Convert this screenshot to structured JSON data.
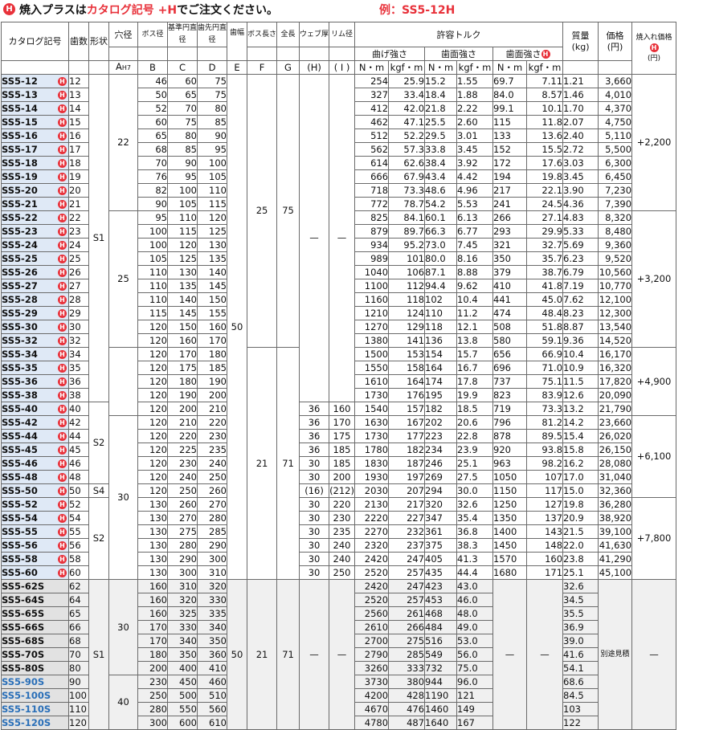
{
  "banner": {
    "h_icon": "H",
    "text_prefix": "焼入プラスは",
    "text_red": "カタログ記号 +H",
    "text_suffix": "でご注文ください。",
    "example": "例：SS5-12H"
  },
  "headers": {
    "catalog": "カタログ記号",
    "teeth": "歯数",
    "shape": "形状",
    "bore": "穴径",
    "boss_dia": "ボス径",
    "pitch_dia": "基準円直径",
    "tip_dia": "歯先円直径",
    "face_width": "歯幅",
    "boss_len": "ボス長さ",
    "total_len": "全長",
    "web": "ウェブ厚",
    "rim": "リム径",
    "torque": "許容トルク",
    "bending": "曲げ強さ",
    "surface": "歯面強さ",
    "surface_h": "歯面強さ",
    "mass": "質量",
    "mass_unit": "(kg)",
    "price": "価格",
    "price_unit": "(円)",
    "hardening_price": "焼入れ価格",
    "hardening_unit": "(円)",
    "col_A": "A",
    "col_A_sub": "H7",
    "col_B": "B",
    "col_C": "C",
    "col_D": "D",
    "col_E": "E",
    "col_F": "F",
    "col_G": "G",
    "col_H": "(H)",
    "col_I": "( I )",
    "nm": "N・m",
    "kgfm": "kgf・m",
    "nm2": "N・m",
    "kgfm2": "kgf・m",
    "nm3": "N・m",
    "kgfm3": "kgf・m"
  },
  "merged": {
    "bore_22": "22",
    "bore_25": "25",
    "bore_30a": "30",
    "bore_30b": "30",
    "bore_40": "40",
    "shape_S1a": "S1",
    "shape_S2a": "S2",
    "shape_S4": "S4",
    "shape_S2b": "S2",
    "shape_S1b": "S1",
    "E_50a": "50",
    "E_50b": "50",
    "F_25": "25",
    "F_21a": "21",
    "F_21b": "21",
    "G_75": "75",
    "G_71a": "71",
    "G_71b": "71",
    "H_dash1": "—",
    "I_dash1": "—",
    "H_dash2": "—",
    "I_dash2": "—",
    "sh_dash1": "—",
    "sk_dash1": "—",
    "price_note": "別途見積",
    "hp_dash": "—",
    "hp_2200": "+2,200",
    "hp_3200": "+3,200",
    "hp_4900": "+4,900",
    "hp_6100": "+6,100",
    "hp_7800": "+7,800"
  },
  "rows": [
    {
      "cat": "SS5-12",
      "h": "H",
      "z": "12",
      "b": "46",
      "c": "60",
      "d": "75",
      "bn": "254",
      "bk": "25.9",
      "sn": "15.2",
      "sk": "1.55",
      "hn": "69.7",
      "hk": "7.11",
      "m": "1.21",
      "p": "3,660"
    },
    {
      "cat": "SS5-13",
      "h": "H",
      "z": "13",
      "b": "50",
      "c": "65",
      "d": "75",
      "bn": "327",
      "bk": "33.4",
      "sn": "18.4",
      "sk": "1.88",
      "hn": "84.0",
      "hk": "8.57",
      "m": "1.46",
      "p": "4,010"
    },
    {
      "cat": "SS5-14",
      "h": "H",
      "z": "14",
      "b": "52",
      "c": "70",
      "d": "80",
      "bn": "412",
      "bk": "42.0",
      "sn": "21.8",
      "sk": "2.22",
      "hn": "99.1",
      "hk": "10.1",
      "m": "1.70",
      "p": "4,370"
    },
    {
      "cat": "SS5-15",
      "h": "H",
      "z": "15",
      "b": "60",
      "c": "75",
      "d": "85",
      "bn": "462",
      "bk": "47.1",
      "sn": "25.5",
      "sk": "2.60",
      "hn": "115",
      "hk": "11.8",
      "m": "2.07",
      "p": "4,750"
    },
    {
      "cat": "SS5-16",
      "h": "H",
      "z": "16",
      "b": "65",
      "c": "80",
      "d": "90",
      "bn": "512",
      "bk": "52.2",
      "sn": "29.5",
      "sk": "3.01",
      "hn": "133",
      "hk": "13.6",
      "m": "2.40",
      "p": "5,110"
    },
    {
      "cat": "SS5-17",
      "h": "H",
      "z": "17",
      "b": "68",
      "c": "85",
      "d": "95",
      "bn": "562",
      "bk": "57.3",
      "sn": "33.8",
      "sk": "3.45",
      "hn": "152",
      "hk": "15.5",
      "m": "2.72",
      "p": "5,500"
    },
    {
      "cat": "SS5-18",
      "h": "H",
      "z": "18",
      "b": "70",
      "c": "90",
      "d": "100",
      "bn": "614",
      "bk": "62.6",
      "sn": "38.4",
      "sk": "3.92",
      "hn": "172",
      "hk": "17.6",
      "m": "3.03",
      "p": "6,300"
    },
    {
      "cat": "SS5-19",
      "h": "H",
      "z": "19",
      "b": "76",
      "c": "95",
      "d": "105",
      "bn": "666",
      "bk": "67.9",
      "sn": "43.4",
      "sk": "4.42",
      "hn": "194",
      "hk": "19.8",
      "m": "3.45",
      "p": "6,450"
    },
    {
      "cat": "SS5-20",
      "h": "H",
      "z": "20",
      "b": "82",
      "c": "100",
      "d": "110",
      "bn": "718",
      "bk": "73.3",
      "sn": "48.6",
      "sk": "4.96",
      "hn": "217",
      "hk": "22.1",
      "m": "3.90",
      "p": "7,230"
    },
    {
      "cat": "SS5-21",
      "h": "H",
      "z": "21",
      "b": "90",
      "c": "105",
      "d": "115",
      "bn": "772",
      "bk": "78.7",
      "sn": "54.2",
      "sk": "5.53",
      "hn": "241",
      "hk": "24.5",
      "m": "4.36",
      "p": "7,390"
    },
    {
      "cat": "SS5-22",
      "h": "H",
      "z": "22",
      "b": "95",
      "c": "110",
      "d": "120",
      "bn": "825",
      "bk": "84.1",
      "sn": "60.1",
      "sk": "6.13",
      "hn": "266",
      "hk": "27.1",
      "m": "4.83",
      "p": "8,320"
    },
    {
      "cat": "SS5-23",
      "h": "H",
      "z": "23",
      "b": "100",
      "c": "115",
      "d": "125",
      "bn": "879",
      "bk": "89.7",
      "sn": "66.3",
      "sk": "6.77",
      "hn": "293",
      "hk": "29.9",
      "m": "5.33",
      "p": "8,480"
    },
    {
      "cat": "SS5-24",
      "h": "H",
      "z": "24",
      "b": "100",
      "c": "120",
      "d": "130",
      "bn": "934",
      "bk": "95.2",
      "sn": "73.0",
      "sk": "7.45",
      "hn": "321",
      "hk": "32.7",
      "m": "5.69",
      "p": "9,360"
    },
    {
      "cat": "SS5-25",
      "h": "H",
      "z": "25",
      "b": "105",
      "c": "125",
      "d": "135",
      "bn": "989",
      "bk": "101",
      "sn": "80.0",
      "sk": "8.16",
      "hn": "350",
      "hk": "35.7",
      "m": "6.23",
      "p": "9,520"
    },
    {
      "cat": "SS5-26",
      "h": "H",
      "z": "26",
      "b": "110",
      "c": "130",
      "d": "140",
      "bn": "1040",
      "bk": "106",
      "sn": "87.1",
      "sk": "8.88",
      "hn": "379",
      "hk": "38.7",
      "m": "6.79",
      "p": "10,560"
    },
    {
      "cat": "SS5-27",
      "h": "H",
      "z": "27",
      "b": "110",
      "c": "135",
      "d": "145",
      "bn": "1100",
      "bk": "112",
      "sn": "94.4",
      "sk": "9.62",
      "hn": "410",
      "hk": "41.8",
      "m": "7.19",
      "p": "10,770"
    },
    {
      "cat": "SS5-28",
      "h": "H",
      "z": "28",
      "b": "110",
      "c": "140",
      "d": "150",
      "bn": "1160",
      "bk": "118",
      "sn": "102",
      "sk": "10.4",
      "hn": "441",
      "hk": "45.0",
      "m": "7.62",
      "p": "12,100"
    },
    {
      "cat": "SS5-29",
      "h": "H",
      "z": "29",
      "b": "115",
      "c": "145",
      "d": "155",
      "bn": "1210",
      "bk": "124",
      "sn": "110",
      "sk": "11.2",
      "hn": "474",
      "hk": "48.4",
      "m": "8.23",
      "p": "12,300"
    },
    {
      "cat": "SS5-30",
      "h": "H",
      "z": "30",
      "b": "120",
      "c": "150",
      "d": "160",
      "bn": "1270",
      "bk": "129",
      "sn": "118",
      "sk": "12.1",
      "hn": "508",
      "hk": "51.8",
      "m": "8.87",
      "p": "13,540"
    },
    {
      "cat": "SS5-32",
      "h": "H",
      "z": "32",
      "b": "120",
      "c": "160",
      "d": "170",
      "bn": "1380",
      "bk": "141",
      "sn": "136",
      "sk": "13.8",
      "hn": "580",
      "hk": "59.1",
      "m": "9.36",
      "p": "14,520"
    },
    {
      "cat": "SS5-34",
      "h": "H",
      "z": "34",
      "b": "120",
      "c": "170",
      "d": "180",
      "bn": "1500",
      "bk": "153",
      "sn": "154",
      "sk": "15.7",
      "hn": "656",
      "hk": "66.9",
      "m": "10.4",
      "p": "16,170"
    },
    {
      "cat": "SS5-35",
      "h": "H",
      "z": "35",
      "b": "120",
      "c": "175",
      "d": "185",
      "bn": "1550",
      "bk": "158",
      "sn": "164",
      "sk": "16.7",
      "hn": "696",
      "hk": "71.0",
      "m": "10.9",
      "p": "16,320"
    },
    {
      "cat": "SS5-36",
      "h": "H",
      "z": "36",
      "b": "120",
      "c": "180",
      "d": "190",
      "bn": "1610",
      "bk": "164",
      "sn": "174",
      "sk": "17.8",
      "hn": "737",
      "hk": "75.1",
      "m": "11.5",
      "p": "17,820"
    },
    {
      "cat": "SS5-38",
      "h": "H",
      "z": "38",
      "b": "120",
      "c": "190",
      "d": "200",
      "bn": "1730",
      "bk": "176",
      "sn": "195",
      "sk": "19.9",
      "hn": "823",
      "hk": "83.9",
      "m": "12.6",
      "p": "20,090"
    },
    {
      "cat": "SS5-40",
      "h": "H",
      "z": "40",
      "b": "120",
      "c": "200",
      "d": "210",
      "wh": "36",
      "ri": "160",
      "bn": "1540",
      "bk": "157",
      "sn": "182",
      "sk": "18.5",
      "hn": "719",
      "hk": "73.3",
      "m": "13.2",
      "p": "21,790"
    },
    {
      "cat": "SS5-42",
      "h": "H",
      "z": "42",
      "b": "120",
      "c": "210",
      "d": "220",
      "wh": "36",
      "ri": "170",
      "bn": "1630",
      "bk": "167",
      "sn": "202",
      "sk": "20.6",
      "hn": "796",
      "hk": "81.2",
      "m": "14.2",
      "p": "23,660"
    },
    {
      "cat": "SS5-44",
      "h": "H",
      "z": "44",
      "b": "120",
      "c": "220",
      "d": "230",
      "wh": "36",
      "ri": "175",
      "bn": "1730",
      "bk": "177",
      "sn": "223",
      "sk": "22.8",
      "hn": "878",
      "hk": "89.5",
      "m": "15.4",
      "p": "26,020"
    },
    {
      "cat": "SS5-45",
      "h": "H",
      "z": "45",
      "b": "120",
      "c": "225",
      "d": "235",
      "wh": "36",
      "ri": "185",
      "bn": "1780",
      "bk": "182",
      "sn": "234",
      "sk": "23.9",
      "hn": "920",
      "hk": "93.8",
      "m": "15.8",
      "p": "26,150"
    },
    {
      "cat": "SS5-46",
      "h": "H",
      "z": "46",
      "b": "120",
      "c": "230",
      "d": "240",
      "wh": "30",
      "ri": "185",
      "bn": "1830",
      "bk": "187",
      "sn": "246",
      "sk": "25.1",
      "hn": "963",
      "hk": "98.2",
      "m": "16.2",
      "p": "28,080"
    },
    {
      "cat": "SS5-48",
      "h": "H",
      "z": "48",
      "b": "120",
      "c": "240",
      "d": "250",
      "wh": "30",
      "ri": "200",
      "bn": "1930",
      "bk": "197",
      "sn": "269",
      "sk": "27.5",
      "hn": "1050",
      "hk": "107",
      "m": "17.0",
      "p": "31,040"
    },
    {
      "cat": "SS5-50",
      "h": "H",
      "z": "50",
      "b": "120",
      "c": "250",
      "d": "260",
      "wh": "(16)",
      "ri": "(212)",
      "bn": "2030",
      "bk": "207",
      "sn": "294",
      "sk": "30.0",
      "hn": "1150",
      "hk": "117",
      "m": "15.0",
      "p": "32,360"
    },
    {
      "cat": "SS5-52",
      "h": "H",
      "z": "52",
      "b": "130",
      "c": "260",
      "d": "270",
      "wh": "30",
      "ri": "220",
      "bn": "2130",
      "bk": "217",
      "sn": "320",
      "sk": "32.6",
      "hn": "1250",
      "hk": "127",
      "m": "19.8",
      "p": "36,280"
    },
    {
      "cat": "SS5-54",
      "h": "H",
      "z": "54",
      "b": "130",
      "c": "270",
      "d": "280",
      "wh": "30",
      "ri": "230",
      "bn": "2220",
      "bk": "227",
      "sn": "347",
      "sk": "35.4",
      "hn": "1350",
      "hk": "137",
      "m": "20.9",
      "p": "38,920"
    },
    {
      "cat": "SS5-55",
      "h": "H",
      "z": "55",
      "b": "130",
      "c": "275",
      "d": "285",
      "wh": "30",
      "ri": "235",
      "bn": "2270",
      "bk": "232",
      "sn": "361",
      "sk": "36.8",
      "hn": "1400",
      "hk": "143",
      "m": "21.5",
      "p": "39,100"
    },
    {
      "cat": "SS5-56",
      "h": "H",
      "z": "56",
      "b": "130",
      "c": "280",
      "d": "290",
      "wh": "30",
      "ri": "240",
      "bn": "2320",
      "bk": "237",
      "sn": "375",
      "sk": "38.3",
      "hn": "1450",
      "hk": "148",
      "m": "22.0",
      "p": "41,630"
    },
    {
      "cat": "SS5-58",
      "h": "H",
      "z": "58",
      "b": "130",
      "c": "290",
      "d": "300",
      "wh": "30",
      "ri": "240",
      "bn": "2420",
      "bk": "247",
      "sn": "405",
      "sk": "41.3",
      "hn": "1570",
      "hk": "160",
      "m": "23.8",
      "p": "41,290"
    },
    {
      "cat": "SS5-60",
      "h": "H",
      "z": "60",
      "b": "130",
      "c": "300",
      "d": "310",
      "wh": "30",
      "ri": "250",
      "bn": "2520",
      "bk": "257",
      "sn": "435",
      "sk": "44.4",
      "hn": "1680",
      "hk": "171",
      "m": "25.1",
      "p": "45,100"
    },
    {
      "cat": "SS5-62S",
      "z": "62",
      "b": "160",
      "c": "310",
      "d": "320",
      "bn": "2420",
      "bk": "247",
      "sn": "423",
      "sk": "43.0",
      "m": "32.6"
    },
    {
      "cat": "SS5-64S",
      "z": "64",
      "b": "160",
      "c": "320",
      "d": "330",
      "bn": "2520",
      "bk": "257",
      "sn": "453",
      "sk": "46.0",
      "m": "34.5"
    },
    {
      "cat": "SS5-65S",
      "z": "65",
      "b": "160",
      "c": "325",
      "d": "335",
      "bn": "2560",
      "bk": "261",
      "sn": "468",
      "sk": "48.0",
      "m": "35.5"
    },
    {
      "cat": "SS5-66S",
      "z": "66",
      "b": "170",
      "c": "330",
      "d": "340",
      "bn": "2610",
      "bk": "266",
      "sn": "484",
      "sk": "49.0",
      "m": "36.9"
    },
    {
      "cat": "SS5-68S",
      "z": "68",
      "b": "170",
      "c": "340",
      "d": "350",
      "bn": "2700",
      "bk": "275",
      "sn": "516",
      "sk": "53.0",
      "m": "39.0"
    },
    {
      "cat": "SS5-70S",
      "z": "70",
      "b": "180",
      "c": "350",
      "d": "360",
      "bn": "2790",
      "bk": "285",
      "sn": "549",
      "sk": "56.0",
      "m": "41.6"
    },
    {
      "cat": "SS5-80S",
      "z": "80",
      "b": "200",
      "c": "400",
      "d": "410",
      "bn": "3260",
      "bk": "333",
      "sn": "732",
      "sk": "75.0",
      "m": "54.1"
    },
    {
      "cat": "SS5-90S",
      "blue": true,
      "z": "90",
      "b": "230",
      "c": "450",
      "d": "460",
      "bn": "3730",
      "bk": "380",
      "sn": "944",
      "sk": "96.0",
      "m": "68.6"
    },
    {
      "cat": "SS5-100S",
      "blue": true,
      "z": "100",
      "b": "250",
      "c": "500",
      "d": "510",
      "bn": "4200",
      "bk": "428",
      "sn": "1190",
      "sk": "121",
      "m": "84.5"
    },
    {
      "cat": "SS5-110S",
      "blue": true,
      "z": "110",
      "b": "280",
      "c": "550",
      "d": "560",
      "bn": "4670",
      "bk": "476",
      "sn": "1460",
      "sk": "149",
      "m": "103"
    },
    {
      "cat": "SS5-120S",
      "blue": true,
      "z": "120",
      "b": "300",
      "c": "600",
      "d": "610",
      "bn": "4780",
      "bk": "487",
      "sn": "1640",
      "sk": "167",
      "m": "122"
    }
  ]
}
